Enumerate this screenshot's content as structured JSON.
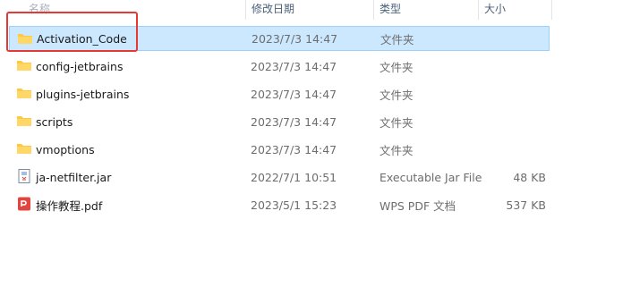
{
  "columns": {
    "name": "名称",
    "date_modified": "修改日期",
    "type": "类型",
    "size": "大小"
  },
  "files": [
    {
      "name": "Activation_Code",
      "date": "2023/7/3 14:47",
      "type": "文件夹",
      "size": "",
      "icon": "folder-icon",
      "selected": true
    },
    {
      "name": "config-jetbrains",
      "date": "2023/7/3 14:47",
      "type": "文件夹",
      "size": "",
      "icon": "folder-icon"
    },
    {
      "name": "plugins-jetbrains",
      "date": "2023/7/3 14:47",
      "type": "文件夹",
      "size": "",
      "icon": "folder-icon"
    },
    {
      "name": "scripts",
      "date": "2023/7/3 14:47",
      "type": "文件夹",
      "size": "",
      "icon": "folder-icon"
    },
    {
      "name": "vmoptions",
      "date": "2023/7/3 14:47",
      "type": "文件夹",
      "size": "",
      "icon": "folder-icon"
    },
    {
      "name": "ja-netfilter.jar",
      "date": "2022/7/1 10:51",
      "type": "Executable Jar File",
      "size": "48 KB",
      "icon": "jar-file-icon"
    },
    {
      "name": "操作教程.pdf",
      "date": "2023/5/1 15:23",
      "type": "WPS PDF 文档",
      "size": "537 KB",
      "icon": "pdf-file-icon"
    }
  ],
  "colors": {
    "selection": "#cce8ff",
    "selection_border": "#99d1ff",
    "folder": "#ffc83d",
    "annotation": "#e53935",
    "pdf": "#e0463f"
  }
}
